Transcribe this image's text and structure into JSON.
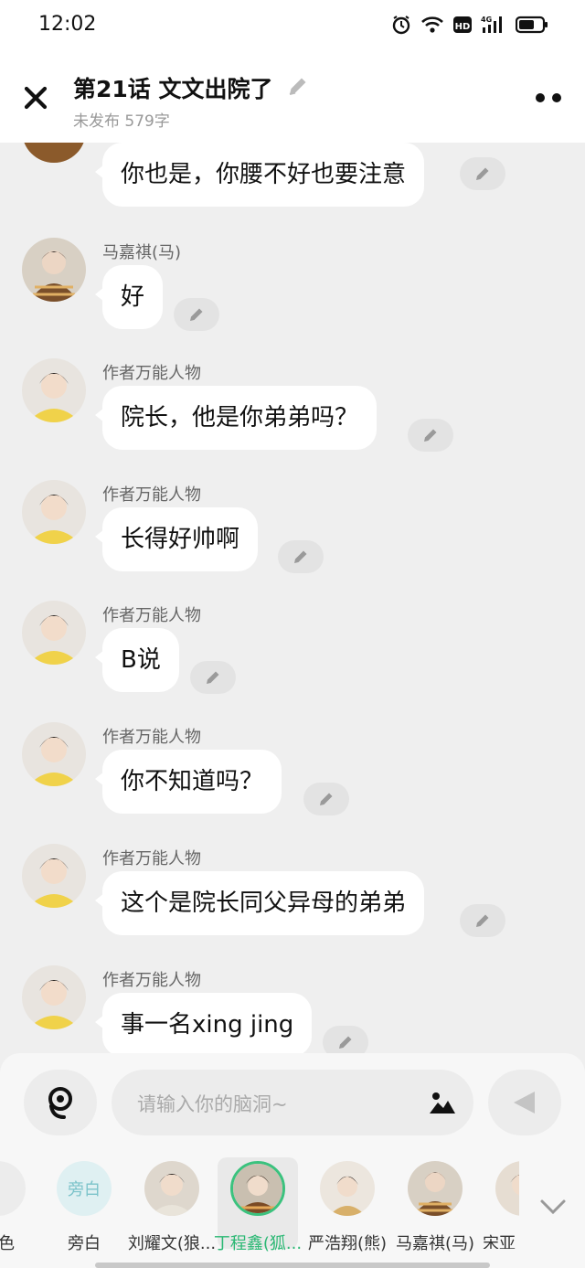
{
  "status_bar": {
    "time": "12:02",
    "icons": [
      "alarm-icon",
      "wifi-icon",
      "hd-icon",
      "signal-4g-icon",
      "battery-icon"
    ]
  },
  "header": {
    "title": "第21话   文文出院了",
    "subtitle": "未发布 579字"
  },
  "messages": [
    {
      "name": "",
      "text": "你也是，你腰不好也要注意"
    },
    {
      "name": "马嘉祺(马)",
      "text": "好"
    },
    {
      "name": "作者万能人物",
      "text": "院长，他是你弟弟吗？"
    },
    {
      "name": "作者万能人物",
      "text": "长得好帅啊"
    },
    {
      "name": "作者万能人物",
      "text": "B说"
    },
    {
      "name": "作者万能人物",
      "text": "你不知道吗？"
    },
    {
      "name": "作者万能人物",
      "text": "这个是院长同父异母的弟弟"
    },
    {
      "name": "作者万能人物",
      "text": "事一名xing jing"
    }
  ],
  "input": {
    "placeholder": "请输入你的脑洞~"
  },
  "roles": [
    {
      "label": "角色"
    },
    {
      "label": "旁白",
      "badge": "旁白"
    },
    {
      "label": "刘耀文(狼..."
    },
    {
      "label": "丁程鑫(狐...",
      "selected": true
    },
    {
      "label": "严浩翔(熊)"
    },
    {
      "label": "马嘉祺(马)"
    },
    {
      "label": "宋亚"
    }
  ],
  "colors": {
    "accent_green": "#2bb874",
    "background": "#efefef",
    "bubble": "#ffffff"
  }
}
